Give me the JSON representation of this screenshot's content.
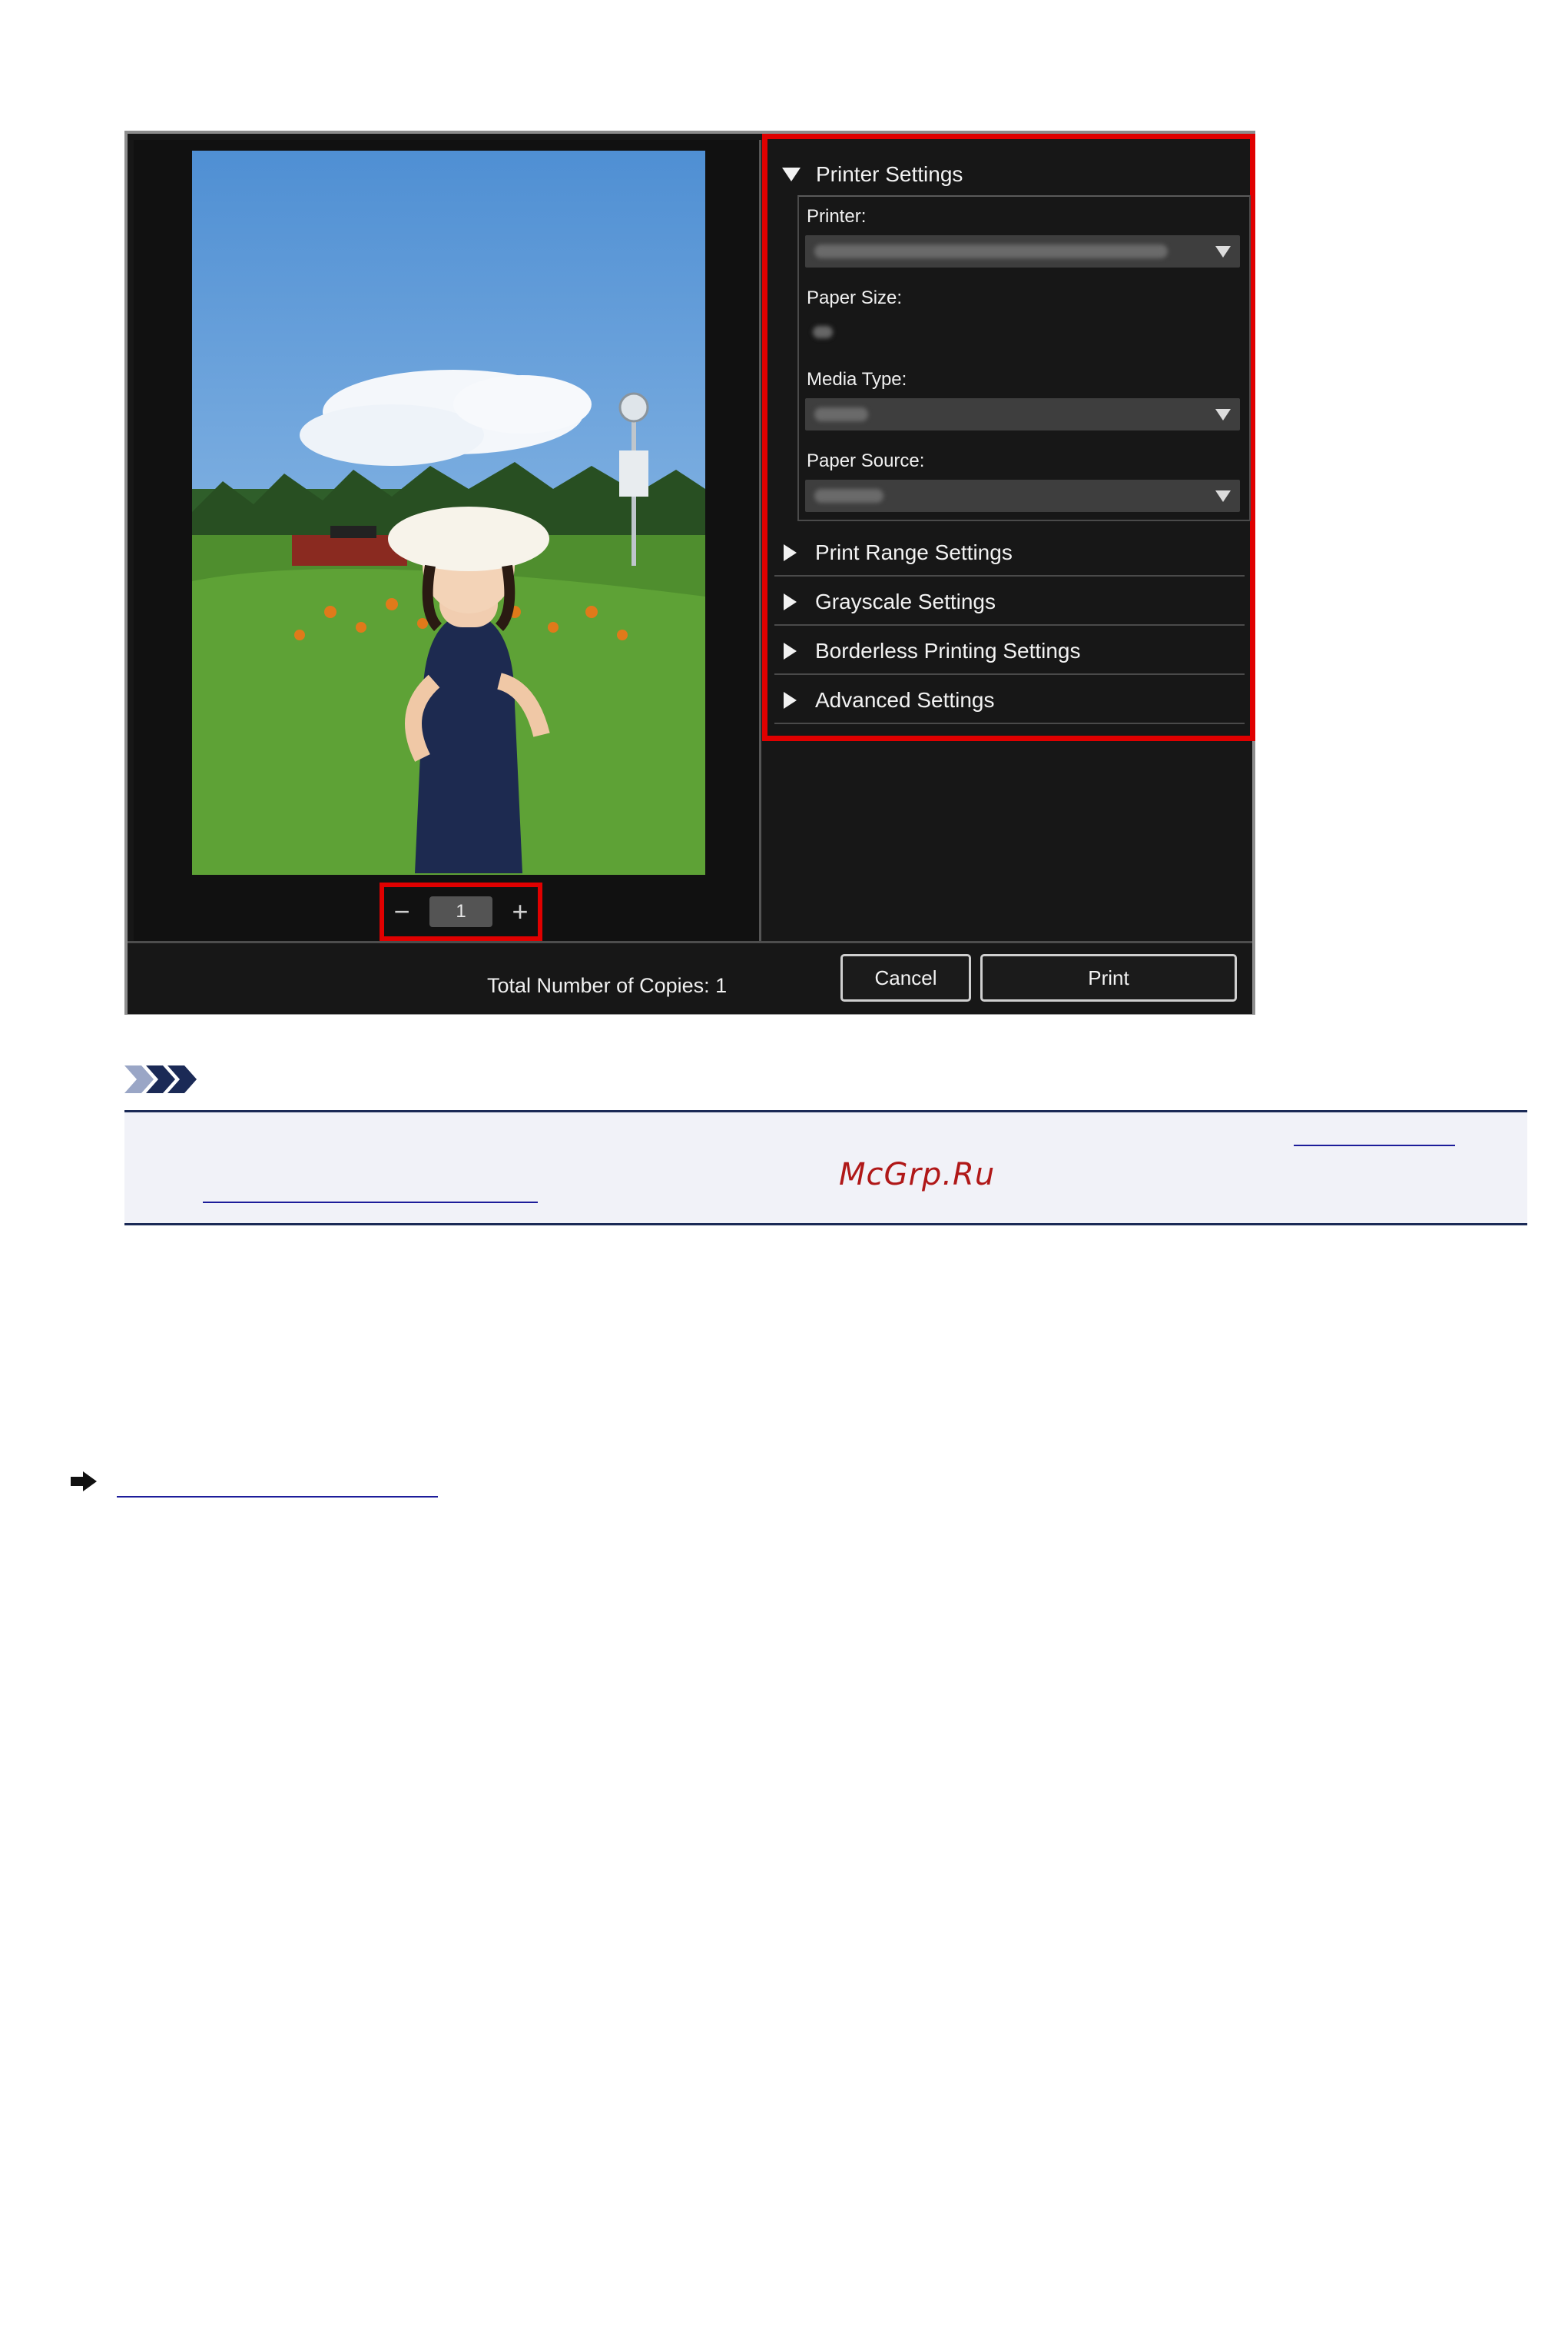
{
  "dialog": {
    "copies": {
      "minus": "−",
      "value": "1",
      "plus": "+"
    },
    "printer_settings": {
      "header": "Printer Settings",
      "printer_label": "Printer:",
      "paper_size_label": "Paper Size:",
      "media_type_label": "Media Type:",
      "paper_source_label": "Paper Source:"
    },
    "sections": [
      "Print Range Settings",
      "Grayscale Settings",
      "Borderless Printing Settings",
      "Advanced Settings"
    ],
    "total_copies": "Total Number of Copies:  1",
    "cancel_label": "Cancel",
    "print_label": "Print"
  },
  "note": {
    "watermark": "McGrp.Ru"
  },
  "colors": {
    "highlight": "#e00000",
    "link": "#1c1c9a",
    "note_rule": "#1b2a56"
  }
}
